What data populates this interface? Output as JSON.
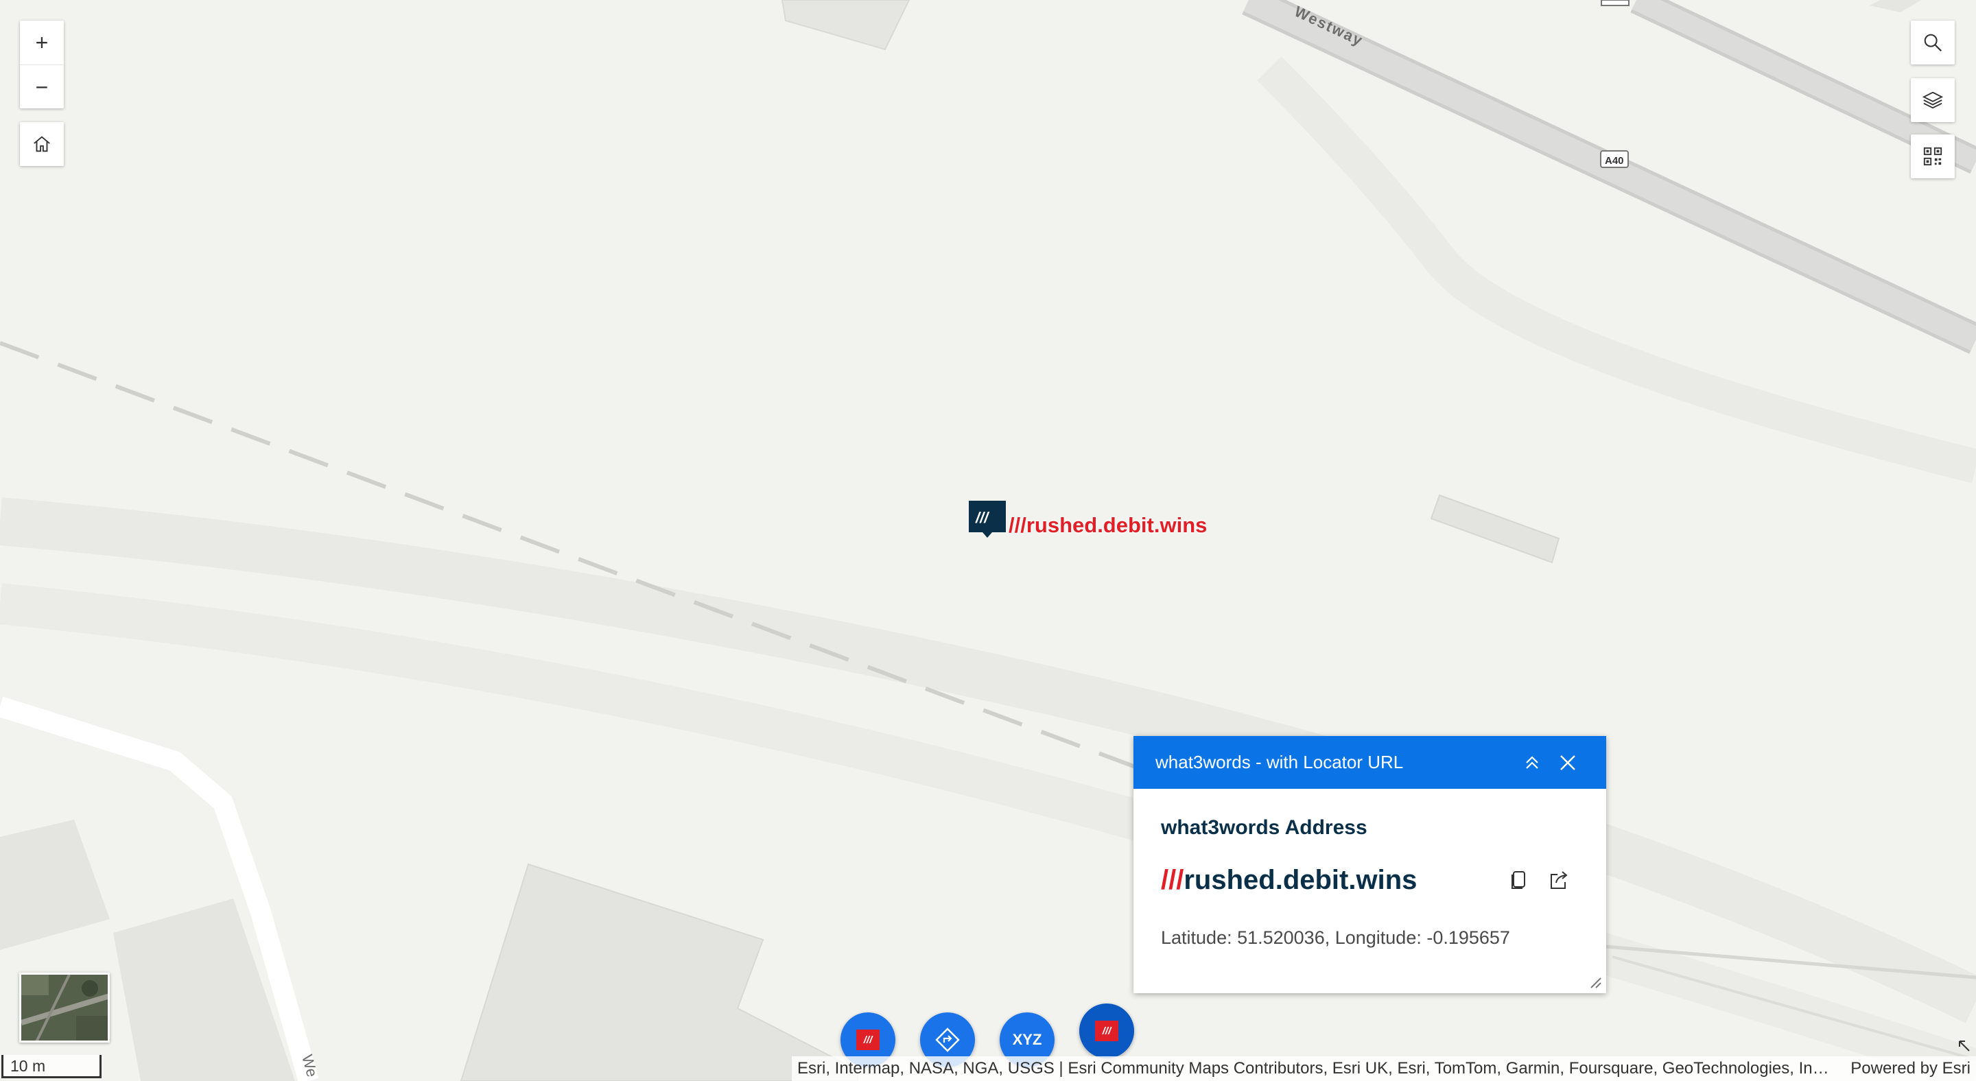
{
  "map": {
    "road_label": "Westway",
    "road_shield": "A40",
    "road_label_partial": "We",
    "marker_label": "///rushed.debit.wins",
    "marker_icon_text": "///"
  },
  "controls": {
    "zoom_in": "+",
    "zoom_out": "−",
    "home_icon": "home-icon",
    "search_icon": "search-icon",
    "layers_icon": "layers-icon",
    "qr_icon": "qr-code-icon"
  },
  "popup": {
    "title": "what3words - with Locator URL",
    "heading": "what3words Address",
    "address_slashes": "///",
    "address_words": "rushed.debit.wins",
    "coordinates": "Latitude: 51.520036, Longitude: -0.195657",
    "header_color": "#0a74e6"
  },
  "fabs": [
    {
      "name": "w3w-red",
      "label": "///"
    },
    {
      "name": "directions",
      "label": ""
    },
    {
      "name": "xyz",
      "label": "XYZ"
    },
    {
      "name": "w3w-active",
      "label": "///"
    }
  ],
  "scale": {
    "label": "10 m"
  },
  "attribution": {
    "text": "Esri, Intermap, NASA, NGA, USGS | Esri Community Maps Contributors, Esri UK, Esri, TomTom, Garmin, Foursquare, GeoTechnologies, Inc, …",
    "powered": "Powered by Esri"
  },
  "colors": {
    "w3w_red": "#e11f26",
    "w3w_navy": "#0a3049",
    "fab_blue": "#1a73e8",
    "map_bg": "#f2f2ef"
  }
}
